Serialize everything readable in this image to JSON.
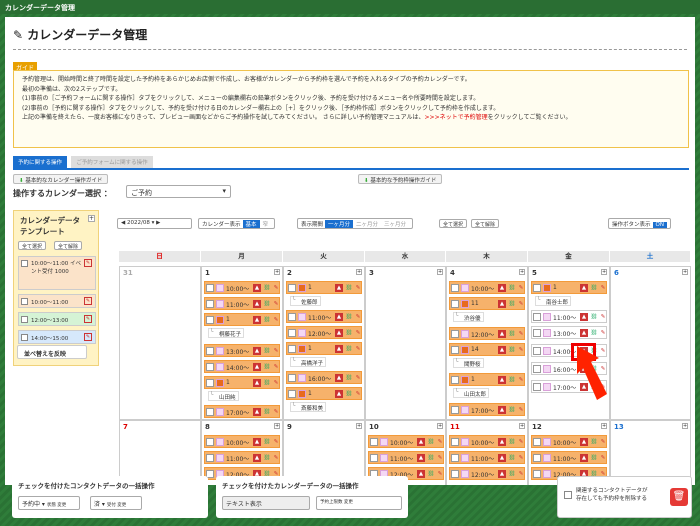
{
  "window_title": "カレンダーデータ管理",
  "page_title": "カレンダーデータ管理",
  "guide": {
    "tag": "ガイド",
    "lines": [
      "予約管理は、開始時間と終了時間を設定した予約枠をあらかじめお店側で作成し、お客様がカレンダーから予約枠を選んで予約を入れるタイプの予約カレンダーです。",
      "最初の準備は、次の2ステップです。",
      "(1)事前の［ご予約フォームに関する操作］タブをクリックして、メニューの編集欄右の鉛筆ボタンをクリック後、予約を受け付けるメニュー名や所要時間を設定します。",
      "(2)事前の［予約に関する操作］タブをクリックして、予約を受け付ける日のカレンダー欄右上の［+］をクリック後、［予約枠作成］ボタンをクリックして予約枠を作成します。",
      "上記の準備を終えたら、一度お客様になりきって、プレビュー画面などからご予約操作を試してみてください。 さらに詳しい予約管理マニュアルは、"
    ],
    "link_text": ">>>ネットで予約管理",
    "link_suffix": "をクリックしてご覧ください。"
  },
  "tabs": [
    "予約に関する操作",
    "ご予約フォームに関する操作"
  ],
  "guide_btn_left": "基本的なカレンダー操作ガイド",
  "guide_btn_right": "基本的な予約枠操作ガイド",
  "select_label": "操作するカレンダー選択 ：",
  "select_value": "ご予約",
  "template": {
    "title1": "カレンダーデータ",
    "title2": "テンプレート",
    "all_select": "全て選択",
    "all_clear": "全て解除",
    "items": [
      "10:00〜11:00 イベント受付 1000",
      "10:00〜11:00",
      "12:00〜13:00",
      "14:00〜15:00"
    ],
    "sort_btn": "並べ替えを反映"
  },
  "toolbar": {
    "month": "2022/08",
    "cal_view": "カレンダー表示",
    "basic": "基本",
    "narrow": "窄",
    "period_label": "表示期間",
    "one_month": "一ヶ月分",
    "two_month": "二ヶ月分",
    "three_month": "三ヶ月分",
    "all_select": "全て選択",
    "all_clear": "全て解除",
    "op_btn_label": "操作ボタン表示",
    "toggle": "ON"
  },
  "weekdays": [
    "日",
    "月",
    "火",
    "水",
    "木",
    "金",
    "土"
  ],
  "week1": [
    "31",
    "1",
    "2",
    "3",
    "4",
    "5",
    "6"
  ],
  "week2": [
    "7",
    "8",
    "9",
    "10",
    "11",
    "12",
    "13"
  ],
  "times": {
    "mon": [
      "10:00〜",
      "11:00〜",
      "1",
      "13:00〜",
      "14:00〜",
      "1",
      "17:00〜"
    ],
    "tue": [
      "1",
      "11:00〜",
      "12:00〜",
      "1",
      "16:00〜",
      "1"
    ],
    "thu": [
      "10:00〜",
      "11",
      "12:00〜",
      "14",
      "1",
      "17:00〜"
    ],
    "fri": [
      "1",
      "11:00〜",
      "13:00〜",
      "14:00〜",
      "16:00〜",
      "17:00〜"
    ]
  },
  "names": {
    "mon1": "桐藤花子",
    "mon2": "山田純",
    "tue1": "佐藤郎",
    "tue2": "高橋洋子",
    "tue3": "斎藤和美",
    "thu1": "渋谷優",
    "thu2": "聞野桜",
    "thu3": "山田太郎",
    "fri1": "南谷士郎"
  },
  "bottom": {
    "contact_title": "チェックを付けたコンタクトデータの一括操作",
    "contact_sel1": "予約中",
    "status_change": "状態\n変更",
    "contact_sel2": "済",
    "accept_change": "受付\n変更",
    "cal_title": "チェックを付けたカレンダーデータの一括操作",
    "text_view": "テキスト表示",
    "limit_change": "予約上限数\n変更",
    "delete_note": "関連するコンタクトデータが\n存在しても予約枠を削除する"
  },
  "colors": {
    "green": "#2a6e33",
    "blue": "#1a6fcf",
    "orange": "#f6b26b",
    "red": "#e53935"
  }
}
